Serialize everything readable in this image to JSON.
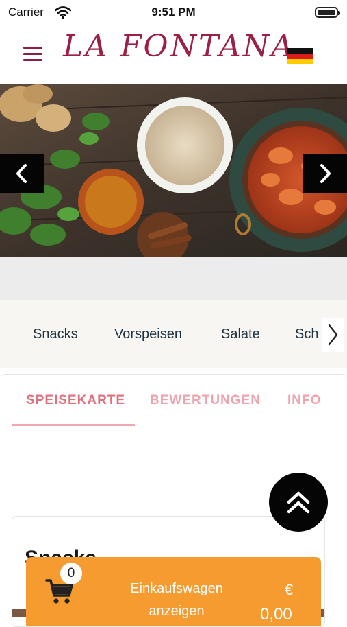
{
  "status_bar": {
    "carrier": "Carrier",
    "time": "9:51 PM"
  },
  "header": {
    "logo": "LA FONTANA",
    "menu_icon": "hamburger-menu-icon",
    "language_flag": "germany-flag-icon",
    "brand_color": "#9c1f44"
  },
  "hero": {
    "prev_icon": "chevron-left-icon",
    "next_icon": "chevron-right-icon"
  },
  "categories": {
    "items": [
      "Snacks",
      "Vorspeisen",
      "Salate",
      "Sch"
    ],
    "next_icon": "chevron-right-icon"
  },
  "tabs": {
    "items": [
      "SPEISEKARTE",
      "BEWERTUNGEN",
      "INFO"
    ],
    "active": "SPEISEKARTE",
    "accent": "#e0707c"
  },
  "scroll_top": {
    "icon": "double-chevron-up-icon"
  },
  "section": {
    "title": "Snacks"
  },
  "cart": {
    "count": "0",
    "label": "Einkaufswagen anzeigen",
    "currency": "€",
    "amount": "0,00",
    "icon": "shopping-cart-icon",
    "color": "#f59b2f"
  }
}
